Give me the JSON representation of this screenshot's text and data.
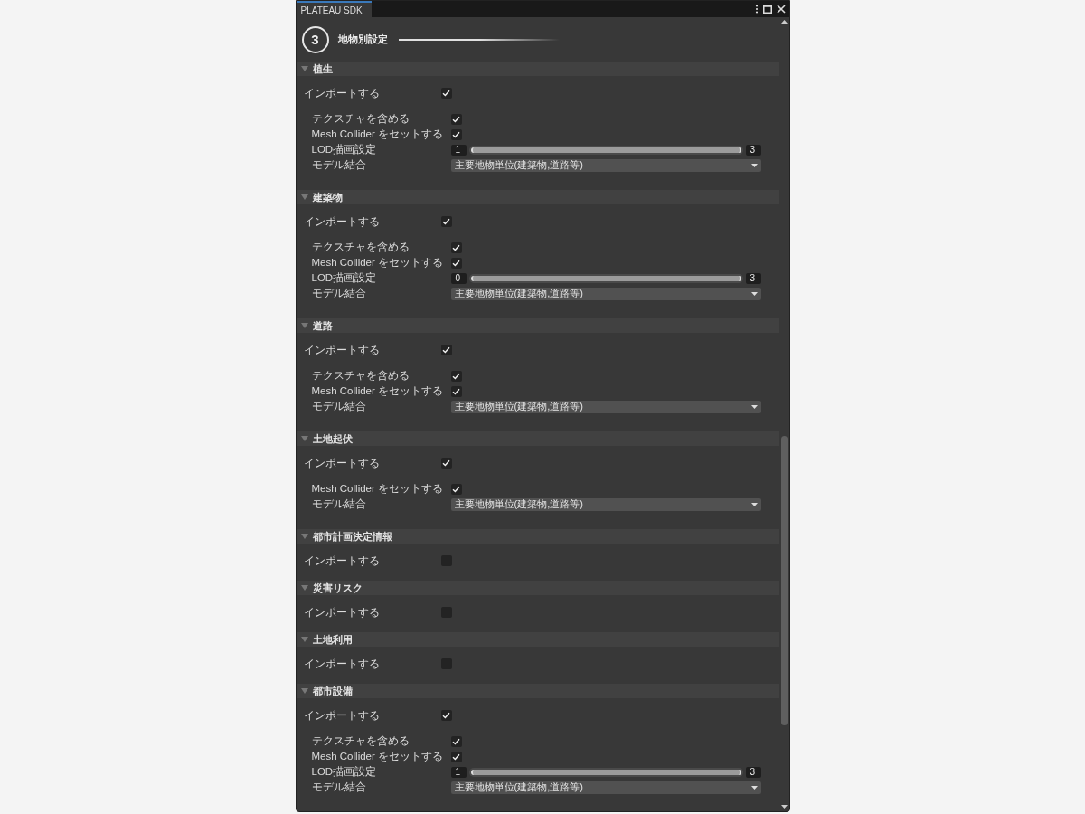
{
  "window": {
    "title": "PLATEAU SDK"
  },
  "step": {
    "number": "3",
    "title": "地物別設定"
  },
  "sections": [
    {
      "title": "植生",
      "expanded": true,
      "import": {
        "label": "インポートする",
        "checked": true
      },
      "options": [
        {
          "kind": "checkbox",
          "label": "テクスチャを含める",
          "checked": true
        },
        {
          "kind": "checkbox",
          "label": "Mesh Collider をセットする",
          "checked": true
        },
        {
          "kind": "range",
          "label": "LOD描画設定",
          "min_value": "1",
          "max_value": "3",
          "level": 1
        },
        {
          "kind": "dropdown",
          "label": "モデル結合",
          "value": "主要地物単位(建築物,道路等)"
        }
      ]
    },
    {
      "title": "建築物",
      "expanded": true,
      "import": {
        "label": "インポートする",
        "checked": true
      },
      "options": [
        {
          "kind": "checkbox",
          "label": "テクスチャを含める",
          "checked": true
        },
        {
          "kind": "checkbox",
          "label": "Mesh Collider をセットする",
          "checked": true
        },
        {
          "kind": "range",
          "label": "LOD描画設定",
          "min_value": "0",
          "max_value": "3",
          "level": 1
        },
        {
          "kind": "dropdown",
          "label": "モデル結合",
          "value": "主要地物単位(建築物,道路等)"
        }
      ]
    },
    {
      "title": "道路",
      "expanded": true,
      "import": {
        "label": "インポートする",
        "checked": true
      },
      "options": [
        {
          "kind": "checkbox",
          "label": "テクスチャを含める",
          "checked": true
        },
        {
          "kind": "checkbox",
          "label": "Mesh Collider をセットする",
          "checked": true
        },
        {
          "kind": "dropdown",
          "label": "モデル結合",
          "value": "主要地物単位(建築物,道路等)"
        }
      ]
    },
    {
      "title": "土地起伏",
      "expanded": true,
      "import": {
        "label": "インポートする",
        "checked": true
      },
      "options": [
        {
          "kind": "checkbox",
          "label": "Mesh Collider をセットする",
          "checked": true
        },
        {
          "kind": "dropdown",
          "label": "モデル結合",
          "value": "主要地物単位(建築物,道路等)"
        }
      ]
    },
    {
      "title": "都市計画決定情報",
      "expanded": true,
      "import": {
        "label": "インポートする",
        "checked": false
      }
    },
    {
      "title": "災害リスク",
      "expanded": true,
      "import": {
        "label": "インポートする",
        "checked": false
      }
    },
    {
      "title": "土地利用",
      "expanded": true,
      "import": {
        "label": "インポートする",
        "checked": false
      }
    },
    {
      "title": "都市設備",
      "expanded": true,
      "import": {
        "label": "インポートする",
        "checked": true
      },
      "options": [
        {
          "kind": "checkbox",
          "label": "テクスチャを含める",
          "checked": true
        },
        {
          "kind": "checkbox",
          "label": "Mesh Collider をセットする",
          "checked": true
        },
        {
          "kind": "range",
          "label": "LOD描画設定",
          "min_value": "1",
          "max_value": "3",
          "level": 1
        },
        {
          "kind": "dropdown",
          "label": "モデル結合",
          "value": "主要地物単位(建築物,道路等)"
        }
      ]
    }
  ]
}
